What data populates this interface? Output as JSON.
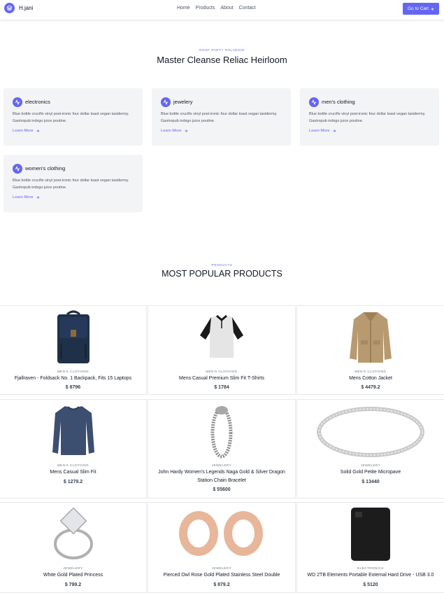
{
  "header": {
    "brand": "H.jani",
    "nav": [
      "Home",
      "Products",
      "About",
      "Contact"
    ],
    "cart_label": "Go to Cart",
    "accent": "#6366f1"
  },
  "hero": {
    "eyebrow": "ROOF PARTY POLAROID",
    "title": "Master Cleanse Reliac Heirloom"
  },
  "categories": [
    {
      "name": "electronics",
      "desc": "Blue bottle crucifix vinyl post-ironic four dollar toast vegan taxidermy. Gastropub indxgo juice poutine.",
      "link": "Learn More"
    },
    {
      "name": "jewelery",
      "desc": "Blue bottle crucifix vinyl post-ironic four dollar toast vegan taxidermy. Gastropub indxgo juice poutine.",
      "link": "Learn More"
    },
    {
      "name": "men's clothing",
      "desc": "Blue bottle crucifix vinyl post-ironic four dollar toast vegan taxidermy. Gastropub indxgo juice poutine.",
      "link": "Learn More"
    },
    {
      "name": "women's clothing",
      "desc": "Blue bottle crucifix vinyl post-ironic four dollar toast vegan taxidermy. Gastropub indxgo juice poutine.",
      "link": "Learn More"
    }
  ],
  "popular": {
    "eyebrow": "PRODUCTS",
    "title": "MOST POPULAR PRODUCTS"
  },
  "products": [
    {
      "category": "MEN'S CLOTHING",
      "name": "Fjallraven - Foldsack No. 1 Backpack, Fits 15 Laptops",
      "price": "$ 8796",
      "icon": "backpack-icon"
    },
    {
      "category": "MEN'S CLOTHING",
      "name": "Mens Casual Premium Slim Fit T-Shirts",
      "price": "$ 1784",
      "icon": "tshirt-icon"
    },
    {
      "category": "MEN'S CLOTHING",
      "name": "Mens Cotton Jacket",
      "price": "$ 4479.2",
      "icon": "jacket-icon"
    },
    {
      "category": "MEN'S CLOTHING",
      "name": "Mens Casual Slim Fit",
      "price": "$ 1279.2",
      "icon": "sweater-icon"
    },
    {
      "category": "JEWELERY",
      "name": "John Hardy Women's Legends Naga Gold & Silver Dragon Station Chain Bracelet",
      "price": "$ 55600",
      "icon": "bracelet-icon"
    },
    {
      "category": "JEWELERY",
      "name": "Solid Gold Petite Micropave",
      "price": "$ 13440",
      "icon": "ring-band-icon"
    },
    {
      "category": "JEWELERY",
      "name": "White Gold Plated Princess",
      "price": "$ 799.2",
      "icon": "diamond-ring-icon"
    },
    {
      "category": "JEWELERY",
      "name": "Pierced Owl Rose Gold Plated Stainless Steel Double",
      "price": "$ 879.2",
      "icon": "ear-plugs-icon"
    },
    {
      "category": "ELECTRONICS",
      "name": "WD 2TB Elements Portable External Hard Drive - USB 3.0",
      "price": "$ 5120",
      "icon": "hard-drive-icon"
    }
  ]
}
